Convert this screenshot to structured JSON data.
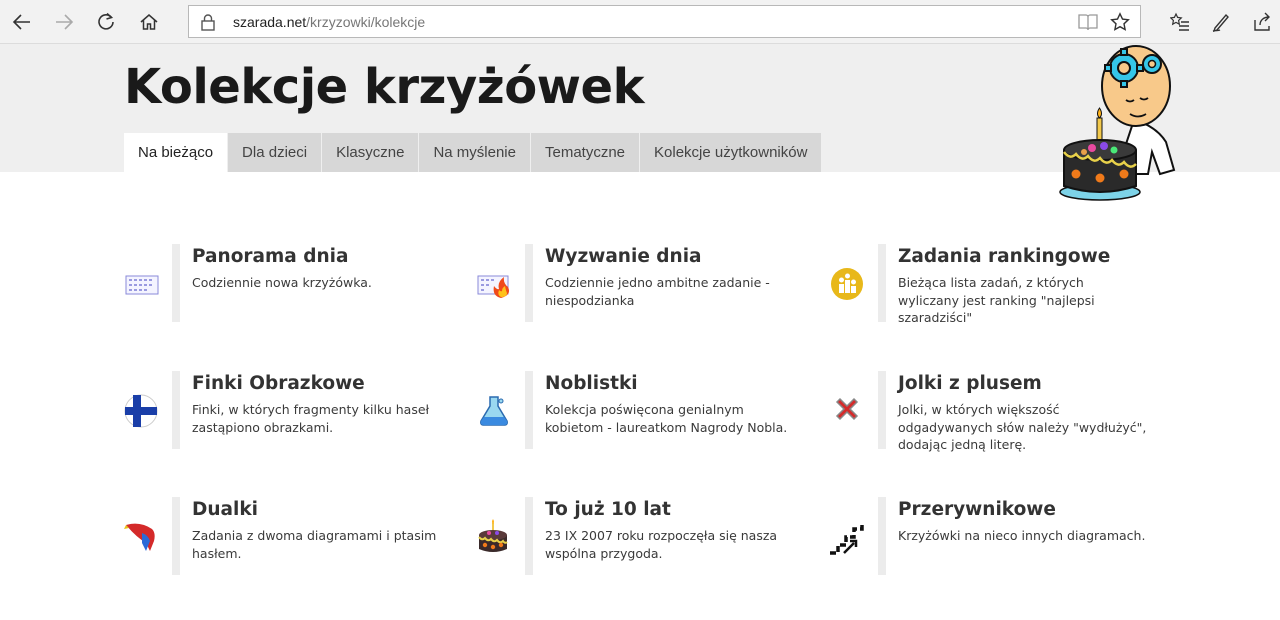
{
  "browser": {
    "url_host": "szarada.net",
    "url_path": "/krzyzowki/kolekcje"
  },
  "header": {
    "title": "Kolekcje krzyżówek",
    "tabs": [
      {
        "label": "Na bieżąco",
        "active": true
      },
      {
        "label": "Dla dzieci",
        "active": false
      },
      {
        "label": "Klasyczne",
        "active": false
      },
      {
        "label": "Na myślenie",
        "active": false
      },
      {
        "label": "Tematyczne",
        "active": false
      },
      {
        "label": "Kolekcje użytkowników",
        "active": false
      }
    ]
  },
  "collections": [
    {
      "title": "Panorama dnia",
      "desc": "Codziennie nowa krzyżówka.",
      "icon": "calendar-icon"
    },
    {
      "title": "Wyzwanie dnia",
      "desc": "Codziennie jedno ambitne zadanie - niespodzianka",
      "icon": "calendar-fire-icon"
    },
    {
      "title": "Zadania rankingowe",
      "desc": "Bieżąca lista zadań, z których wyliczany jest ranking \"najlepsi szaradziści\"",
      "icon": "trophy-icon"
    },
    {
      "title": "Finki Obrazkowe",
      "desc": "Finki, w których fragmenty kilku haseł zastąpiono obrazkami.",
      "icon": "finland-flag-icon"
    },
    {
      "title": "Noblistki",
      "desc": "Kolekcja poświęcona genialnym kobietom - laureatkom Nagrody Nobla.",
      "icon": "flask-icon"
    },
    {
      "title": "Jolki z plusem",
      "desc": "Jolki, w których większość odgadywanych słów należy \"wydłużyć\", dodając jedną literę.",
      "icon": "red-x-icon"
    },
    {
      "title": "Dualki",
      "desc": "Zadania z dwoma diagramami i ptasim hasłem.",
      "icon": "parrot-icon"
    },
    {
      "title": "To już 10 lat",
      "desc": "23 IX 2007 roku rozpoczęła się nasza wspólna przygoda.",
      "icon": "cake-icon"
    },
    {
      "title": "Przerywnikowe",
      "desc": "Krzyżówki na nieco innych diagramach.",
      "icon": "stairs-icon"
    }
  ]
}
